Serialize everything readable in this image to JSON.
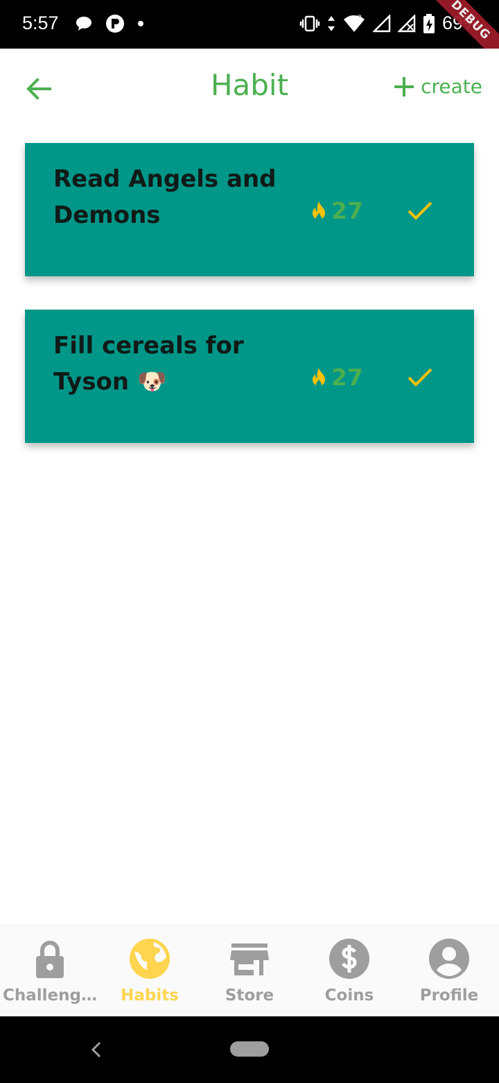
{
  "status_bar": {
    "time": "5:57",
    "battery": "69%",
    "debug_label": "DEBUG"
  },
  "header": {
    "title": "Habit",
    "create_label": "create"
  },
  "habits": [
    {
      "title": "Read Angels and Demons",
      "streak": "27"
    },
    {
      "title": "Fill cereals for Tyson 🐶",
      "streak": "27"
    }
  ],
  "bottom_nav": [
    {
      "label": "Challeng…",
      "icon": "lock-icon",
      "active": false
    },
    {
      "label": "Habits",
      "icon": "globe-icon",
      "active": true
    },
    {
      "label": "Store",
      "icon": "store-icon",
      "active": false
    },
    {
      "label": "Coins",
      "icon": "dollar-icon",
      "active": false
    },
    {
      "label": "Profile",
      "icon": "account-icon",
      "active": false
    }
  ],
  "colors": {
    "accent_green": "#4caf50",
    "card_teal": "#009688",
    "highlight_yellow": "#ffd54f",
    "check_yellow": "#ffc107",
    "inactive_gray": "#9e9e9e"
  }
}
